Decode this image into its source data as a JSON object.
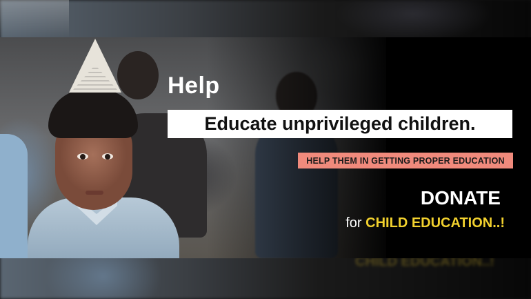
{
  "banner": {
    "headline": "Help",
    "subheadline": "Educate unprivileged children.",
    "tagline": "HELP THEM IN GETTING PROPER EDUCATION",
    "cta_title": "DONATE",
    "cta_prefix": "for",
    "cta_highlight": "CHILD EDUCATION..!"
  },
  "colors": {
    "tag_bg": "#f08a7c",
    "highlight": "#f2d12e",
    "text_light": "#ffffff",
    "background": "#000000"
  }
}
